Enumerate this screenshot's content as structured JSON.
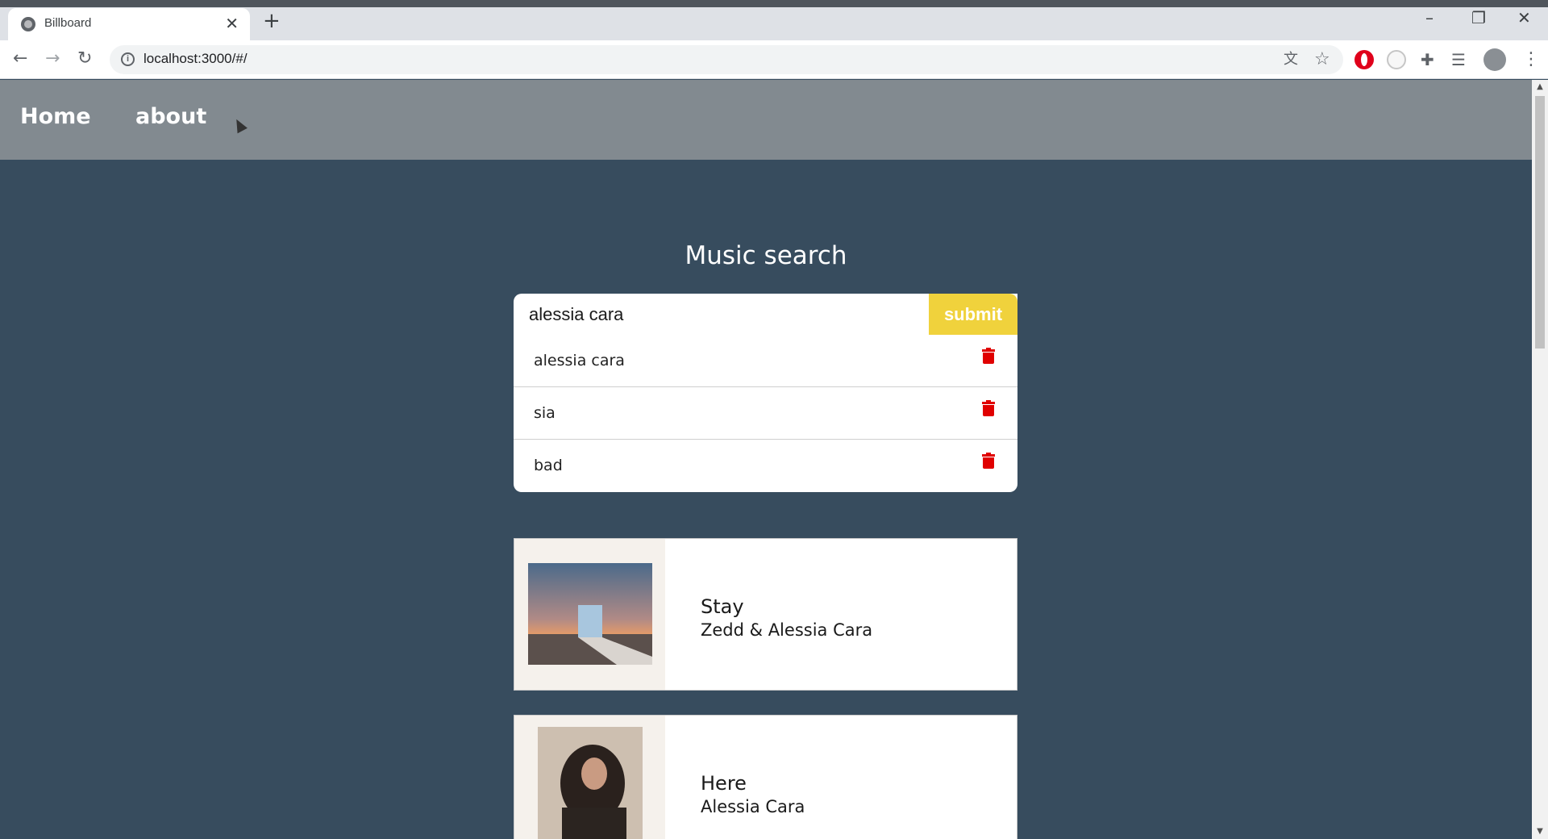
{
  "browser": {
    "tab_title": "Billboard",
    "url": "localhost:3000/#/"
  },
  "site_nav": {
    "home_label": "Home",
    "about_label": "about"
  },
  "page": {
    "title": "Music search"
  },
  "search": {
    "value": "alessia cara",
    "submit_label": "submit"
  },
  "history": {
    "items": [
      {
        "label": "alessia cara"
      },
      {
        "label": "sia"
      },
      {
        "label": "bad"
      }
    ]
  },
  "songs": [
    {
      "title": "Stay",
      "artist": "Zedd & Alessia Cara"
    },
    {
      "title": "Here",
      "artist": "Alessia Cara"
    }
  ],
  "colors": {
    "page_background": "#374c5e",
    "submit_button": "#f0d23c",
    "trash_icon": "#e00000",
    "nav_background": "#828a90"
  },
  "icons": [
    "globe-icon",
    "close-icon",
    "plus-icon",
    "back-icon",
    "forward-icon",
    "reload-icon",
    "info-icon",
    "translate-icon",
    "star-icon",
    "trash-icon",
    "puzzle-icon"
  ]
}
